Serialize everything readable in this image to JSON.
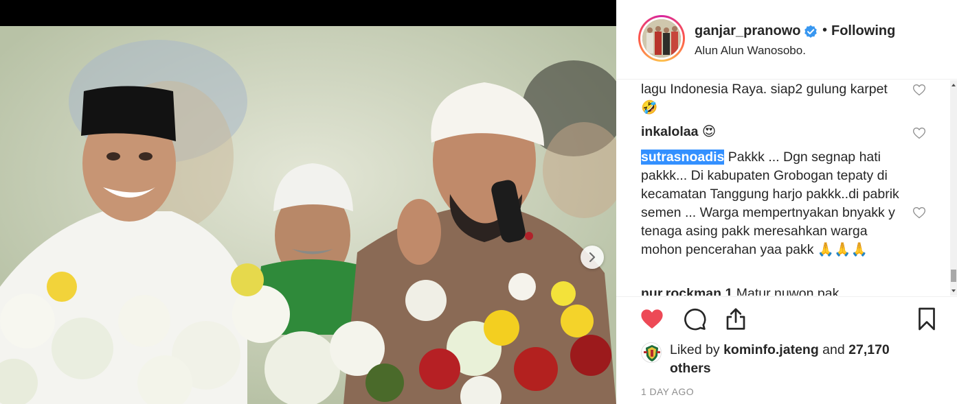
{
  "post": {
    "username": "ganjar_pranowo",
    "separator": "•",
    "follow_state": "Following",
    "location": "Alun Alun Wanosobo."
  },
  "comments": [
    {
      "user": "",
      "text": "lagu Indonesia Raya. siap2 gulung karpet 🤣"
    },
    {
      "user": "inkalolaa",
      "text": "😍"
    },
    {
      "user": "sutrasnoadis",
      "text": "Pakkk ... Dgn segnap hati pakkk... Di kabupaten Grobogan tepaty di kecamatan Tanggung harjo pakkk..di pabrik semen ... Warga mempertnyakan bnyakk y tenaga asing pakk meresahkan warga mohon pencerahan yaa pakk 🙏🙏🙏"
    },
    {
      "user": "nur.rockman.1",
      "text": "Matur nuwon pak"
    }
  ],
  "likes": {
    "prefix": "Liked by",
    "liker": "kominfo.jateng",
    "conj": "and",
    "others": "27,170 others"
  },
  "timestamp": "1 DAY AGO",
  "colors": {
    "like_red": "#ed4956",
    "verified_blue": "#3897f0",
    "selection_blue": "#3390ff"
  },
  "icons": [
    "chevron-right-icon",
    "verified-icon",
    "heart-icon",
    "comment-icon",
    "share-icon",
    "bookmark-icon"
  ]
}
